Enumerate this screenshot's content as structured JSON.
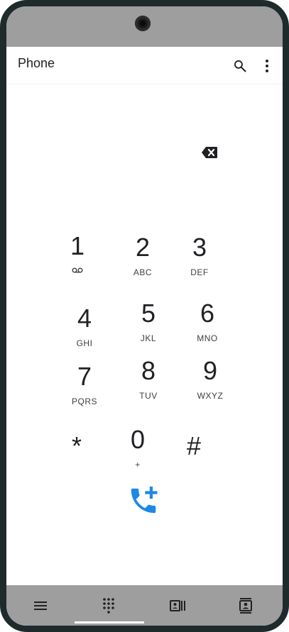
{
  "status_bar": {
    "camera": "front-camera"
  },
  "app_bar": {
    "title": "Phone",
    "icons": {
      "search": "search-icon",
      "more": "more-vert-icon"
    }
  },
  "dialer": {
    "number": "",
    "backspace_icon": "backspace-icon",
    "keys": [
      {
        "digit": "1",
        "letters": "",
        "icon": "voicemail-icon"
      },
      {
        "digit": "2",
        "letters": "ABC"
      },
      {
        "digit": "3",
        "letters": "DEF"
      },
      {
        "digit": "4",
        "letters": "GHI"
      },
      {
        "digit": "5",
        "letters": "JKL"
      },
      {
        "digit": "6",
        "letters": "MNO"
      },
      {
        "digit": "7",
        "letters": "PQRS"
      },
      {
        "digit": "8",
        "letters": "TUV"
      },
      {
        "digit": "9",
        "letters": "WXYZ"
      },
      {
        "digit": "*",
        "letters": ""
      },
      {
        "digit": "0",
        "letters": "+"
      },
      {
        "digit": "#",
        "letters": ""
      }
    ],
    "add_contact_icon": "add-call-icon",
    "accent_color": "#1e88e5"
  },
  "bottom_nav": {
    "items": [
      {
        "icon": "menu-icon"
      },
      {
        "icon": "dialpad-icon",
        "active": true
      },
      {
        "icon": "contacts-list-icon"
      },
      {
        "icon": "contact-card-icon"
      }
    ]
  }
}
